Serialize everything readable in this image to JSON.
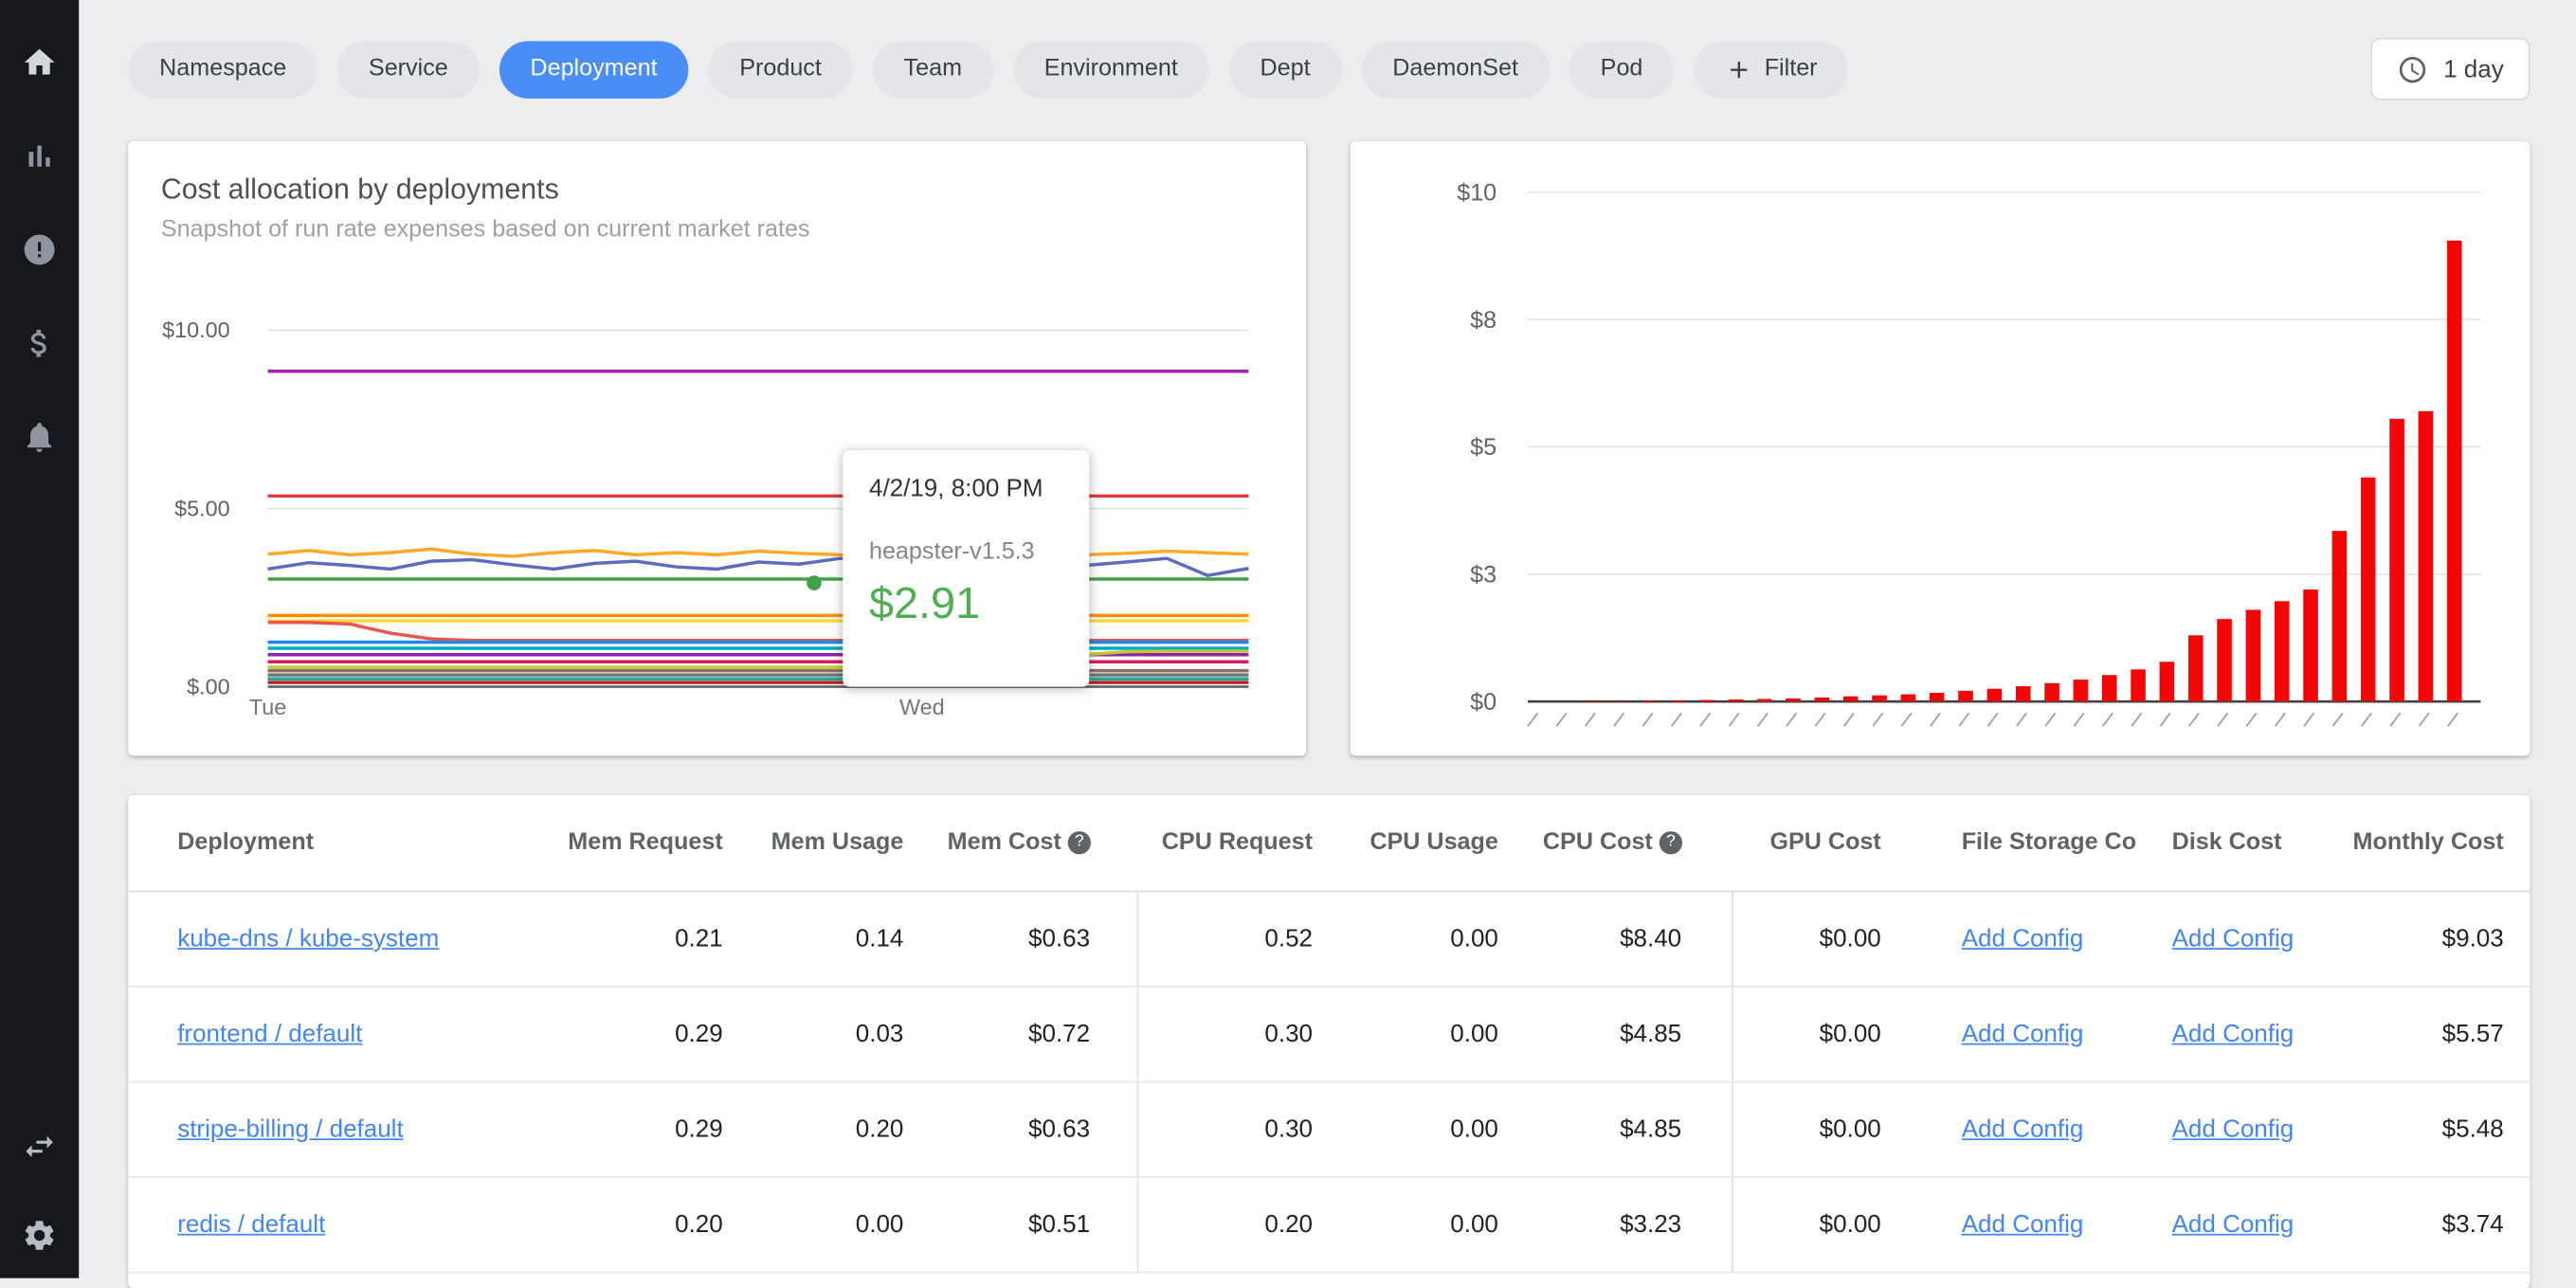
{
  "sidebar": {
    "icons": [
      "home",
      "bar-chart",
      "alert",
      "dollar",
      "bell"
    ],
    "bottom_icons": [
      "swap-horizontal",
      "settings-gear"
    ]
  },
  "filter_bar": {
    "chips": [
      {
        "label": "Namespace",
        "active": false
      },
      {
        "label": "Service",
        "active": false
      },
      {
        "label": "Deployment",
        "active": true
      },
      {
        "label": "Product",
        "active": false
      },
      {
        "label": "Team",
        "active": false
      },
      {
        "label": "Environment",
        "active": false
      },
      {
        "label": "Dept",
        "active": false
      },
      {
        "label": "DaemonSet",
        "active": false
      },
      {
        "label": "Pod",
        "active": false
      }
    ],
    "add_filter_label": "Filter",
    "time_range_label": "1 day",
    "accent_color": "#4a8df8"
  },
  "left_card": {
    "title": "Cost allocation by deployments",
    "subtitle": "Snapshot of run rate expenses based on current market rates",
    "tooltip": {
      "date": "4/2/19, 8:00 PM",
      "series": "heapster-v1.5.3",
      "value": "$2.91"
    }
  },
  "chart_data": [
    {
      "id": "cost-allocation-line",
      "type": "line",
      "title": "Cost allocation by deployments",
      "ylim": [
        0,
        10
      ],
      "grid": true,
      "y_ticks": [
        {
          "v": 0,
          "label": "$.00"
        },
        {
          "v": 5,
          "label": "$5.00"
        },
        {
          "v": 10,
          "label": "$10.00"
        }
      ],
      "x_labels": [
        {
          "frac": 0.0,
          "label": "Tue"
        },
        {
          "frac": 0.667,
          "label": "Wed"
        }
      ],
      "highlight_point": {
        "frac": 0.557,
        "value": 2.91,
        "color": "#43a047",
        "series": "heapster-v1.5.3"
      },
      "series": [
        {
          "color": "#9c27b0",
          "values": [
            8.85,
            8.85
          ]
        },
        {
          "color": "#e53935",
          "values": [
            5.35,
            5.35
          ]
        },
        {
          "color": "#ffa726",
          "values": [
            3.72,
            3.82,
            3.7,
            3.76,
            3.86,
            3.72,
            3.66,
            3.76,
            3.82,
            3.7,
            3.76,
            3.7,
            3.8,
            3.74,
            3.7,
            3.66,
            3.76,
            3.82,
            3.7,
            3.76,
            3.7,
            3.74,
            3.8,
            3.76,
            3.72
          ]
        },
        {
          "color": "#5c6bc0",
          "values": [
            3.3,
            3.48,
            3.4,
            3.3,
            3.52,
            3.56,
            3.42,
            3.3,
            3.46,
            3.52,
            3.36,
            3.3,
            3.5,
            3.44,
            3.6,
            3.52,
            3.02,
            3.12,
            3.5,
            3.46,
            3.4,
            3.5,
            3.6,
            3.12,
            3.32
          ]
        },
        {
          "color": "#43a047",
          "values": [
            3.02,
            3.02
          ]
        },
        {
          "color": "#fb8c00",
          "values": [
            2.0,
            2.0
          ]
        },
        {
          "color": "#fdd835",
          "values": [
            1.85,
            1.85
          ]
        },
        {
          "color": "#ef5350",
          "values": [
            1.8,
            1.8,
            1.76,
            1.5,
            1.34,
            1.3,
            1.3,
            1.3,
            1.3,
            1.3,
            1.3,
            1.3,
            1.3,
            1.3,
            1.3,
            1.3,
            1.3,
            1.3,
            1.3,
            1.3,
            1.3,
            1.3,
            1.3,
            1.3,
            1.3
          ]
        },
        {
          "color": "#1e88e5",
          "values": [
            1.25,
            1.25
          ]
        },
        {
          "color": "#00acc1",
          "values": [
            1.08,
            1.08
          ]
        },
        {
          "color": "#8e24aa",
          "values": [
            0.9,
            0.9
          ]
        },
        {
          "color": "#c0ca33",
          "values": [
            0.55,
            0.55,
            0.55,
            0.55,
            0.55,
            0.55,
            0.55,
            0.55,
            0.55,
            0.55,
            0.55,
            0.55,
            0.55,
            0.55,
            0.55,
            0.55,
            0.55,
            0.58,
            0.66,
            0.78,
            0.9,
            0.98,
            1.0,
            1.0,
            1.0
          ]
        },
        {
          "color": "#d81b60",
          "values": [
            0.7,
            0.7
          ]
        },
        {
          "color": "#8d6e63",
          "values": [
            0.45,
            0.45
          ]
        },
        {
          "color": "#757575",
          "values": [
            0.33,
            0.33
          ]
        },
        {
          "color": "#26a69a",
          "values": [
            0.22,
            0.22
          ]
        },
        {
          "color": "#b71c1c",
          "values": [
            0.12,
            0.12
          ]
        }
      ]
    },
    {
      "id": "cost-per-deployment-bars",
      "type": "bar",
      "bar_color": "#f40606",
      "ylim": [
        0,
        10
      ],
      "grid": true,
      "y_ticks": [
        {
          "v": 0,
          "label": "$0"
        },
        {
          "v": 2.5,
          "label": "$3"
        },
        {
          "v": 5,
          "label": "$5"
        },
        {
          "v": 7.5,
          "label": "$8"
        },
        {
          "v": 10,
          "label": "$10"
        }
      ],
      "values": [
        0,
        0,
        0.01,
        0.01,
        0.02,
        0.02,
        0.03,
        0.04,
        0.05,
        0.06,
        0.08,
        0.1,
        0.12,
        0.14,
        0.17,
        0.21,
        0.25,
        0.3,
        0.36,
        0.43,
        0.52,
        0.63,
        0.78,
        1.3,
        1.62,
        1.8,
        1.97,
        2.2,
        3.35,
        4.4,
        5.55,
        5.7,
        9.05
      ]
    }
  ],
  "table": {
    "columns": [
      {
        "label": "Deployment"
      },
      {
        "label": "Mem Request"
      },
      {
        "label": "Mem Usage"
      },
      {
        "label": "Mem Cost",
        "help": true
      },
      {
        "label": "CPU Request"
      },
      {
        "label": "CPU Usage"
      },
      {
        "label": "CPU Cost",
        "help": true
      },
      {
        "label": "GPU Cost"
      },
      {
        "label": "File Storage Co"
      },
      {
        "label": "Disk Cost"
      },
      {
        "label": "Monthly Cost"
      }
    ],
    "link_label": "Add Config",
    "rows": [
      [
        "kube-dns / kube-system",
        "0.21",
        "0.14",
        "$0.63",
        "0.52",
        "0.00",
        "$8.40",
        "$0.00",
        "Add Config",
        "Add Config",
        "$9.03"
      ],
      [
        "frontend / default",
        "0.29",
        "0.03",
        "$0.72",
        "0.30",
        "0.00",
        "$4.85",
        "$0.00",
        "Add Config",
        "Add Config",
        "$5.57"
      ],
      [
        "stripe-billing / default",
        "0.29",
        "0.20",
        "$0.63",
        "0.30",
        "0.00",
        "$4.85",
        "$0.00",
        "Add Config",
        "Add Config",
        "$5.48"
      ],
      [
        "redis / default",
        "0.20",
        "0.00",
        "$0.51",
        "0.20",
        "0.00",
        "$3.23",
        "$0.00",
        "Add Config",
        "Add Config",
        "$3.74"
      ]
    ]
  }
}
